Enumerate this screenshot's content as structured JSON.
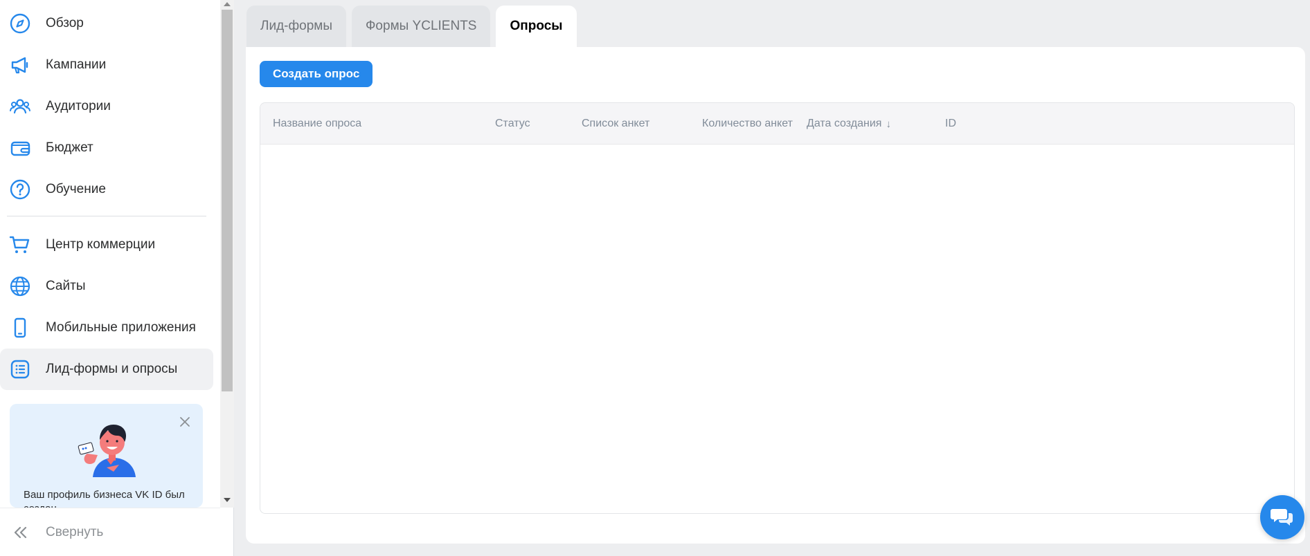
{
  "sidebar": {
    "items": [
      {
        "label": "Обзор",
        "icon": "compass-icon"
      },
      {
        "label": "Кампании",
        "icon": "megaphone-icon"
      },
      {
        "label": "Аудитории",
        "icon": "users-icon"
      },
      {
        "label": "Бюджет",
        "icon": "wallet-icon"
      },
      {
        "label": "Обучение",
        "icon": "question-circle-icon"
      },
      {
        "label": "Центр коммерции",
        "icon": "cart-icon"
      },
      {
        "label": "Сайты",
        "icon": "globe-icon"
      },
      {
        "label": "Мобильные приложения",
        "icon": "smartphone-icon"
      },
      {
        "label": "Лид-формы и опросы",
        "icon": "list-icon"
      }
    ],
    "active_item": "Лид-формы и опросы",
    "promo": {
      "text": "Ваш профиль бизнеса VK ID был создан"
    },
    "collapse_label": "Свернуть"
  },
  "main": {
    "tabs": [
      {
        "label": "Лид-формы"
      },
      {
        "label": "Формы YCLIENTS"
      },
      {
        "label": "Опросы"
      }
    ],
    "active_tab": "Опросы",
    "create_button": "Создать опрос",
    "table": {
      "columns": [
        {
          "label": "Название опроса"
        },
        {
          "label": "Статус"
        },
        {
          "label": "Список анкет"
        },
        {
          "label": "Количество анкет"
        },
        {
          "label": "Дата создания",
          "sort": "↓"
        },
        {
          "label": "ID"
        }
      ],
      "rows": []
    }
  },
  "colors": {
    "accent": "#2688eb",
    "background": "#edeef0",
    "panel": "#ffffff"
  }
}
